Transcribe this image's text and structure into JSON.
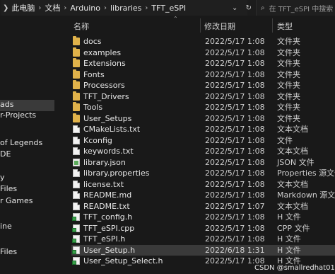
{
  "address_bar": {
    "breadcrumbs": [
      "此电脑",
      "文档",
      "Arduino",
      "libraries",
      "TFT_eSPI"
    ],
    "search_placeholder": "在 TFT_eSPI 中搜索"
  },
  "nav": {
    "items": [
      {
        "label": "ads"
      },
      {
        "label": "r-Projects"
      },
      {
        "label": "of Legends"
      },
      {
        "label": "DE"
      },
      {
        "label": "y"
      },
      {
        "label": "Files"
      },
      {
        "label": "r Games"
      },
      {
        "label": "ine"
      },
      {
        "label": "Files"
      }
    ]
  },
  "columns": {
    "name": "名称",
    "date": "修改日期",
    "type": "类型"
  },
  "files": [
    {
      "name": "docs",
      "date": "2022/5/17 1:08",
      "type": "文件夹",
      "icon": "folder-icon"
    },
    {
      "name": "examples",
      "date": "2022/5/17 1:08",
      "type": "文件夹",
      "icon": "folder-icon"
    },
    {
      "name": "Extensions",
      "date": "2022/5/17 1:08",
      "type": "文件夹",
      "icon": "folder-icon"
    },
    {
      "name": "Fonts",
      "date": "2022/5/17 1:08",
      "type": "文件夹",
      "icon": "folder-icon"
    },
    {
      "name": "Processors",
      "date": "2022/5/17 1:08",
      "type": "文件夹",
      "icon": "folder-icon"
    },
    {
      "name": "TFT_Drivers",
      "date": "2022/5/17 1:08",
      "type": "文件夹",
      "icon": "folder-icon"
    },
    {
      "name": "Tools",
      "date": "2022/5/17 1:08",
      "type": "文件夹",
      "icon": "folder-icon"
    },
    {
      "name": "User_Setups",
      "date": "2022/5/17 1:08",
      "type": "文件夹",
      "icon": "folder-icon"
    },
    {
      "name": "CMakeLists.txt",
      "date": "2022/5/17 1:08",
      "type": "文本文档",
      "icon": "text-file-icon"
    },
    {
      "name": "Kconfig",
      "date": "2022/5/17 1:08",
      "type": "文件",
      "icon": "file-icon"
    },
    {
      "name": "keywords.txt",
      "date": "2022/5/17 1:08",
      "type": "文本文档",
      "icon": "text-file-icon"
    },
    {
      "name": "library.json",
      "date": "2022/5/17 1:08",
      "type": "JSON 文件",
      "icon": "json-file-icon"
    },
    {
      "name": "library.properties",
      "date": "2022/5/17 1:08",
      "type": "Properties 源文件",
      "icon": "properties-file-icon"
    },
    {
      "name": "license.txt",
      "date": "2022/5/17 1:08",
      "type": "文本文档",
      "icon": "text-file-icon"
    },
    {
      "name": "README.md",
      "date": "2022/5/17 1:08",
      "type": "Markdown 源文件",
      "icon": "markdown-file-icon"
    },
    {
      "name": "README.txt",
      "date": "2022/5/17 1:07",
      "type": "文本文档",
      "icon": "text-file-icon"
    },
    {
      "name": "TFT_config.h",
      "date": "2022/5/17 1:08",
      "type": "H 文件",
      "icon": "code-file-icon"
    },
    {
      "name": "TFT_eSPI.cpp",
      "date": "2022/5/17 1:08",
      "type": "CPP 文件",
      "icon": "code-file-icon"
    },
    {
      "name": "TFT_eSPI.h",
      "date": "2022/5/17 1:08",
      "type": "H 文件",
      "icon": "code-file-icon"
    },
    {
      "name": "User_Setup.h",
      "date": "2022/6/18 1:31",
      "type": "H 文件",
      "icon": "code-file-icon",
      "selected": true
    },
    {
      "name": "User_Setup_Select.h",
      "date": "2022/5/17 1:08",
      "type": "H 文件",
      "icon": "code-file-icon"
    }
  ],
  "watermark": "CSDN @smallredhat01",
  "colors": {
    "folder": "#e0b24a",
    "selection": "#3a3a3a",
    "background": "#191919"
  }
}
